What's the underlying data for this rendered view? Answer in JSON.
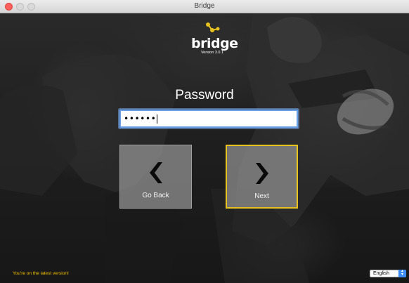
{
  "window": {
    "title": "Bridge"
  },
  "logo": {
    "wordmark": "bridge",
    "version": "Version 3.0.1"
  },
  "form": {
    "heading": "Password",
    "password_value": "••••••"
  },
  "buttons": {
    "back_label": "Go Back",
    "next_label": "Next"
  },
  "footer": {
    "status": "You're on the latest version!",
    "language_selected": "English"
  },
  "colors": {
    "accent_yellow": "#e8c21e",
    "focus_blue": "#6aa0e6"
  }
}
